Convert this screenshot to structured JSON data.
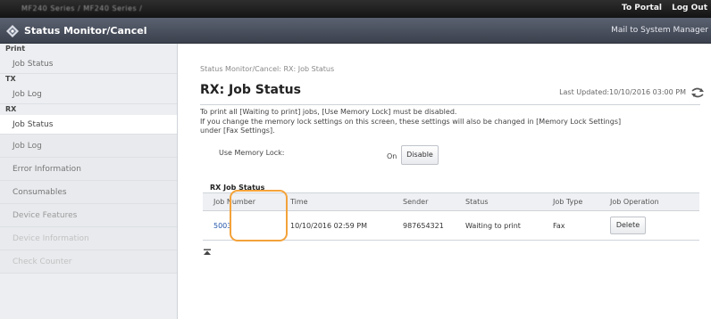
{
  "header": {
    "device_name": "MF240 Series / MF240 Series /",
    "links": {
      "portal": "To Portal",
      "logout": "Log Out"
    }
  },
  "titlebar": {
    "app_title": "Status Monitor/Cancel",
    "mail_link": "Mail to System Manager"
  },
  "sidebar": {
    "print_head": "Print",
    "print_job_status": "Job Status",
    "tx_head": "TX",
    "tx_job_log": "Job Log",
    "rx_head": "RX",
    "rx_job_status": "Job Status",
    "rx_job_log": "Job Log",
    "error_information": "Error Information",
    "consumables": "Consumables",
    "device_features": "Device Features",
    "device_information": "Device Information",
    "check_counter": "Check Counter"
  },
  "main": {
    "breadcrumb": "Status Monitor/Cancel: RX: Job Status",
    "title": "RX: Job Status",
    "last_updated": "Last Updated:10/10/2016 03:00 PM",
    "notice_line1": "To print all [Waiting to print] jobs, [Use Memory Lock] must be disabled.",
    "notice_line2": "If you change the memory lock settings on this screen, these settings will also be changed in [Memory Lock Settings]",
    "notice_line3": "under [Fax Settings].",
    "memory_lock_label": "Use Memory Lock:",
    "memory_lock_value": "On",
    "disable_button": "Disable",
    "rx_job_status_heading": "RX Job Status",
    "columns": {
      "job_number": "Job Number",
      "time": "Time",
      "sender": "Sender",
      "status": "Status",
      "job_type": "Job Type",
      "job_operation": "Job Operation"
    },
    "row": {
      "job_number": "5003",
      "time": "10/10/2016 02:59 PM",
      "sender": "987654321",
      "status": "Waiting to print",
      "job_type": "Fax",
      "operation": "Delete"
    }
  },
  "colors": {
    "topbar": "#1c1c1c",
    "titlebar": "#4a505d",
    "sidebar": "#eceef1",
    "highlight": "#f3a23a",
    "link": "#2255aa"
  }
}
